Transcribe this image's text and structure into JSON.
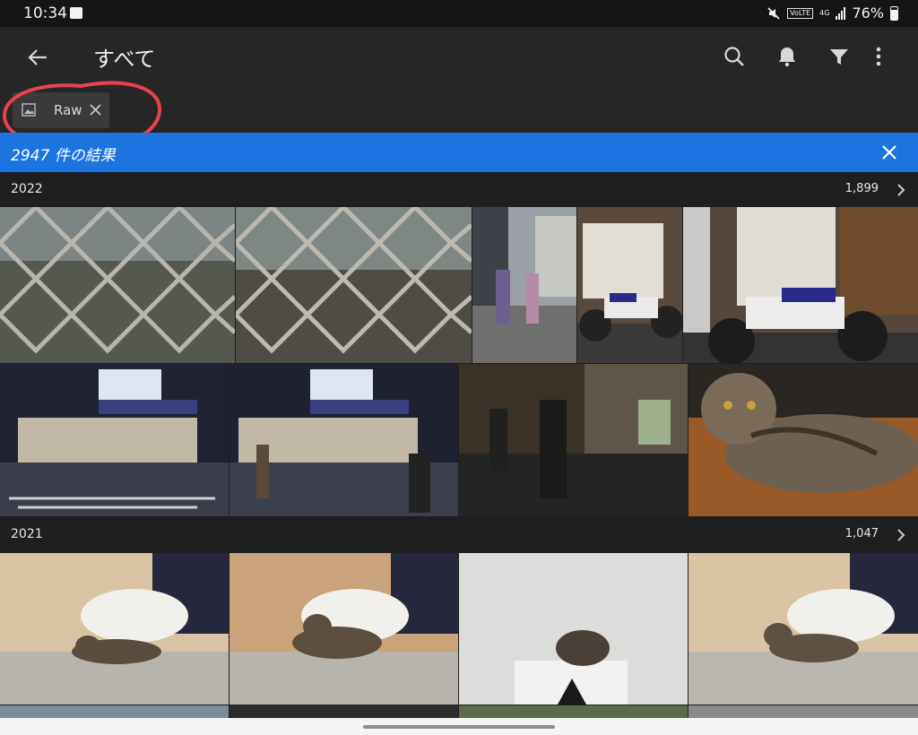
{
  "status_bar": {
    "time": "10:34",
    "battery": "76%",
    "signal": "4G",
    "volte": "VoLTE"
  },
  "app_bar": {
    "title": "すべて"
  },
  "filter_chip": {
    "label": "Raw"
  },
  "results_banner": {
    "text": "2947 件の結果"
  },
  "sections": [
    {
      "year": "2022",
      "count": "1,899"
    },
    {
      "year": "2021",
      "count": "1,047"
    }
  ],
  "photos": [
    {
      "subject": "fence-city-view",
      "year": "2022"
    },
    {
      "subject": "fence-railway-view",
      "year": "2022"
    },
    {
      "subject": "street-walkers",
      "year": "2022"
    },
    {
      "subject": "motorcycle-parked",
      "year": "2022"
    },
    {
      "subject": "motorcycle-closeup",
      "year": "2022"
    },
    {
      "subject": "abc-mart-night",
      "year": "2022"
    },
    {
      "subject": "abc-mart-crossing",
      "year": "2022"
    },
    {
      "subject": "night-street-walker",
      "year": "2022"
    },
    {
      "subject": "tabby-cat-table",
      "year": "2022"
    },
    {
      "subject": "cat-on-sofa",
      "year": "2021"
    },
    {
      "subject": "cat-on-sofa-2",
      "year": "2021"
    },
    {
      "subject": "cat-on-box",
      "year": "2021"
    },
    {
      "subject": "cat-on-sofa-3",
      "year": "2021"
    }
  ],
  "colors": {
    "accent": "#1c74e0",
    "background": "#1e1e1e",
    "annotation": "#e8434c"
  }
}
